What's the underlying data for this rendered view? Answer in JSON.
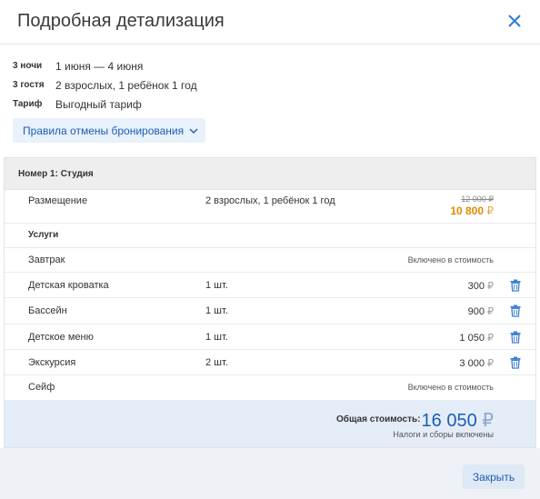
{
  "header": {
    "title": "Подробная детализация",
    "close_icon": "close-icon"
  },
  "summary": [
    {
      "key": "3 ночи",
      "value": "1 июня — 4 июня"
    },
    {
      "key": "3 гостя",
      "value": "2 взрослых, 1 ребёнок 1 год"
    },
    {
      "key": "Тариф",
      "value": "Выгодный тариф"
    }
  ],
  "rules_button": {
    "label": "Правила отмены бронирования",
    "icon": "chevron-down-icon"
  },
  "room": {
    "title": "Номер 1: Студия",
    "accommodation": {
      "label": "Размещение",
      "guests": "2 взрослых, 1 ребёнок 1 год",
      "old_price": "12 000 ₽",
      "new_price": "10 800",
      "currency": "₽"
    },
    "services_header": "Услуги",
    "services": [
      {
        "name": "Завтрак",
        "qty": "",
        "price": "Включено в стоимость",
        "included": true,
        "removable": false
      },
      {
        "name": "Детская кроватка",
        "qty": "1 шт.",
        "price": "300",
        "included": false,
        "removable": true
      },
      {
        "name": "Бассейн",
        "qty": "1 шт.",
        "price": "900",
        "included": false,
        "removable": true
      },
      {
        "name": "Детское меню",
        "qty": "1 шт.",
        "price": "1 050",
        "included": false,
        "removable": true
      },
      {
        "name": "Экскурсия",
        "qty": "2 шт.",
        "price": "3 000",
        "included": false,
        "removable": true
      },
      {
        "name": "Сейф",
        "qty": "",
        "price": "Включено в стоимость",
        "included": true,
        "removable": false
      }
    ],
    "currency": "₽"
  },
  "total": {
    "label": "Общая стоимость:",
    "value": "16 050",
    "currency": "₽",
    "note": "Налоги и сборы включены"
  },
  "footer": {
    "close_label": "Закрыть"
  },
  "colors": {
    "accent": "#1a5fb4",
    "discount_price": "#e08a00",
    "total_background": "#e4ecf7",
    "room_header_background": "#eeeeee"
  }
}
